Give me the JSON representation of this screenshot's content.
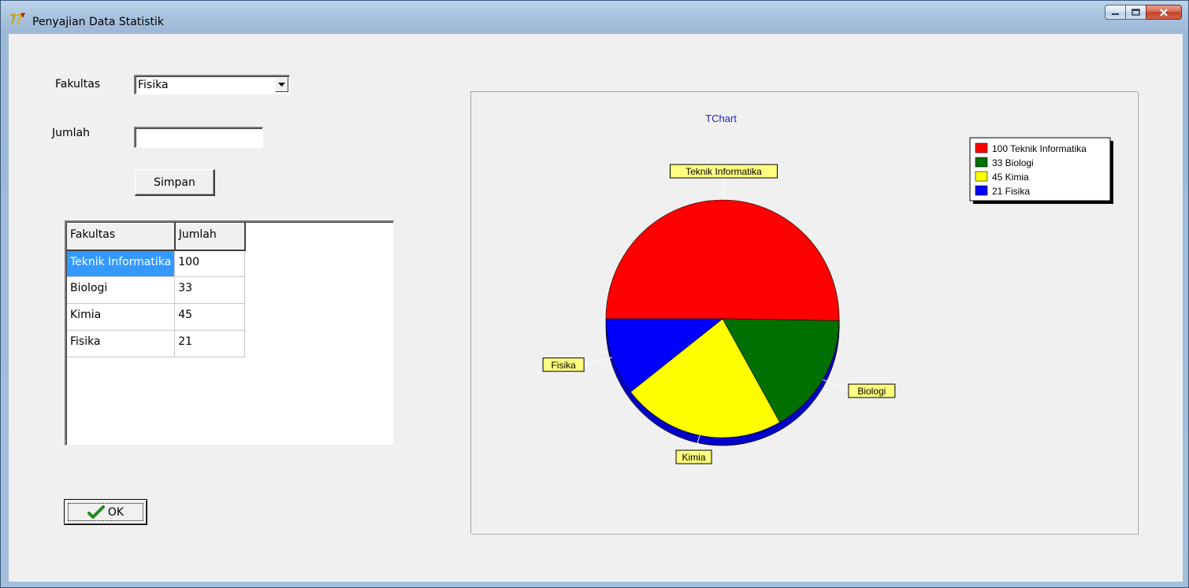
{
  "window": {
    "title": "Penyajian Data Statistik"
  },
  "form": {
    "fakultas_label": "Fakultas",
    "fakultas_value": "Fisika",
    "jumlah_label": "Jumlah",
    "jumlah_value": "",
    "simpan_label": "Simpan",
    "ok_label": "OK"
  },
  "grid": {
    "headers": [
      "Fakultas",
      "Jumlah"
    ],
    "rows": [
      [
        "Teknik Informatika",
        "100"
      ],
      [
        "Biologi",
        "33"
      ],
      [
        "Kimia",
        "45"
      ],
      [
        "Fisika",
        "21"
      ]
    ]
  },
  "chart_data": {
    "type": "pie",
    "title": "TChart",
    "categories": [
      "Teknik Informatika",
      "Biologi",
      "Kimia",
      "Fisika"
    ],
    "values": [
      100,
      33,
      45,
      21
    ],
    "colors": [
      "#ff0000",
      "#007000",
      "#ffff00",
      "#0000ff"
    ],
    "legend": [
      "100 Teknik Informatika",
      "33 Biologi",
      "45 Kimia",
      "21 Fisika"
    ],
    "legend_position": "top-right"
  }
}
